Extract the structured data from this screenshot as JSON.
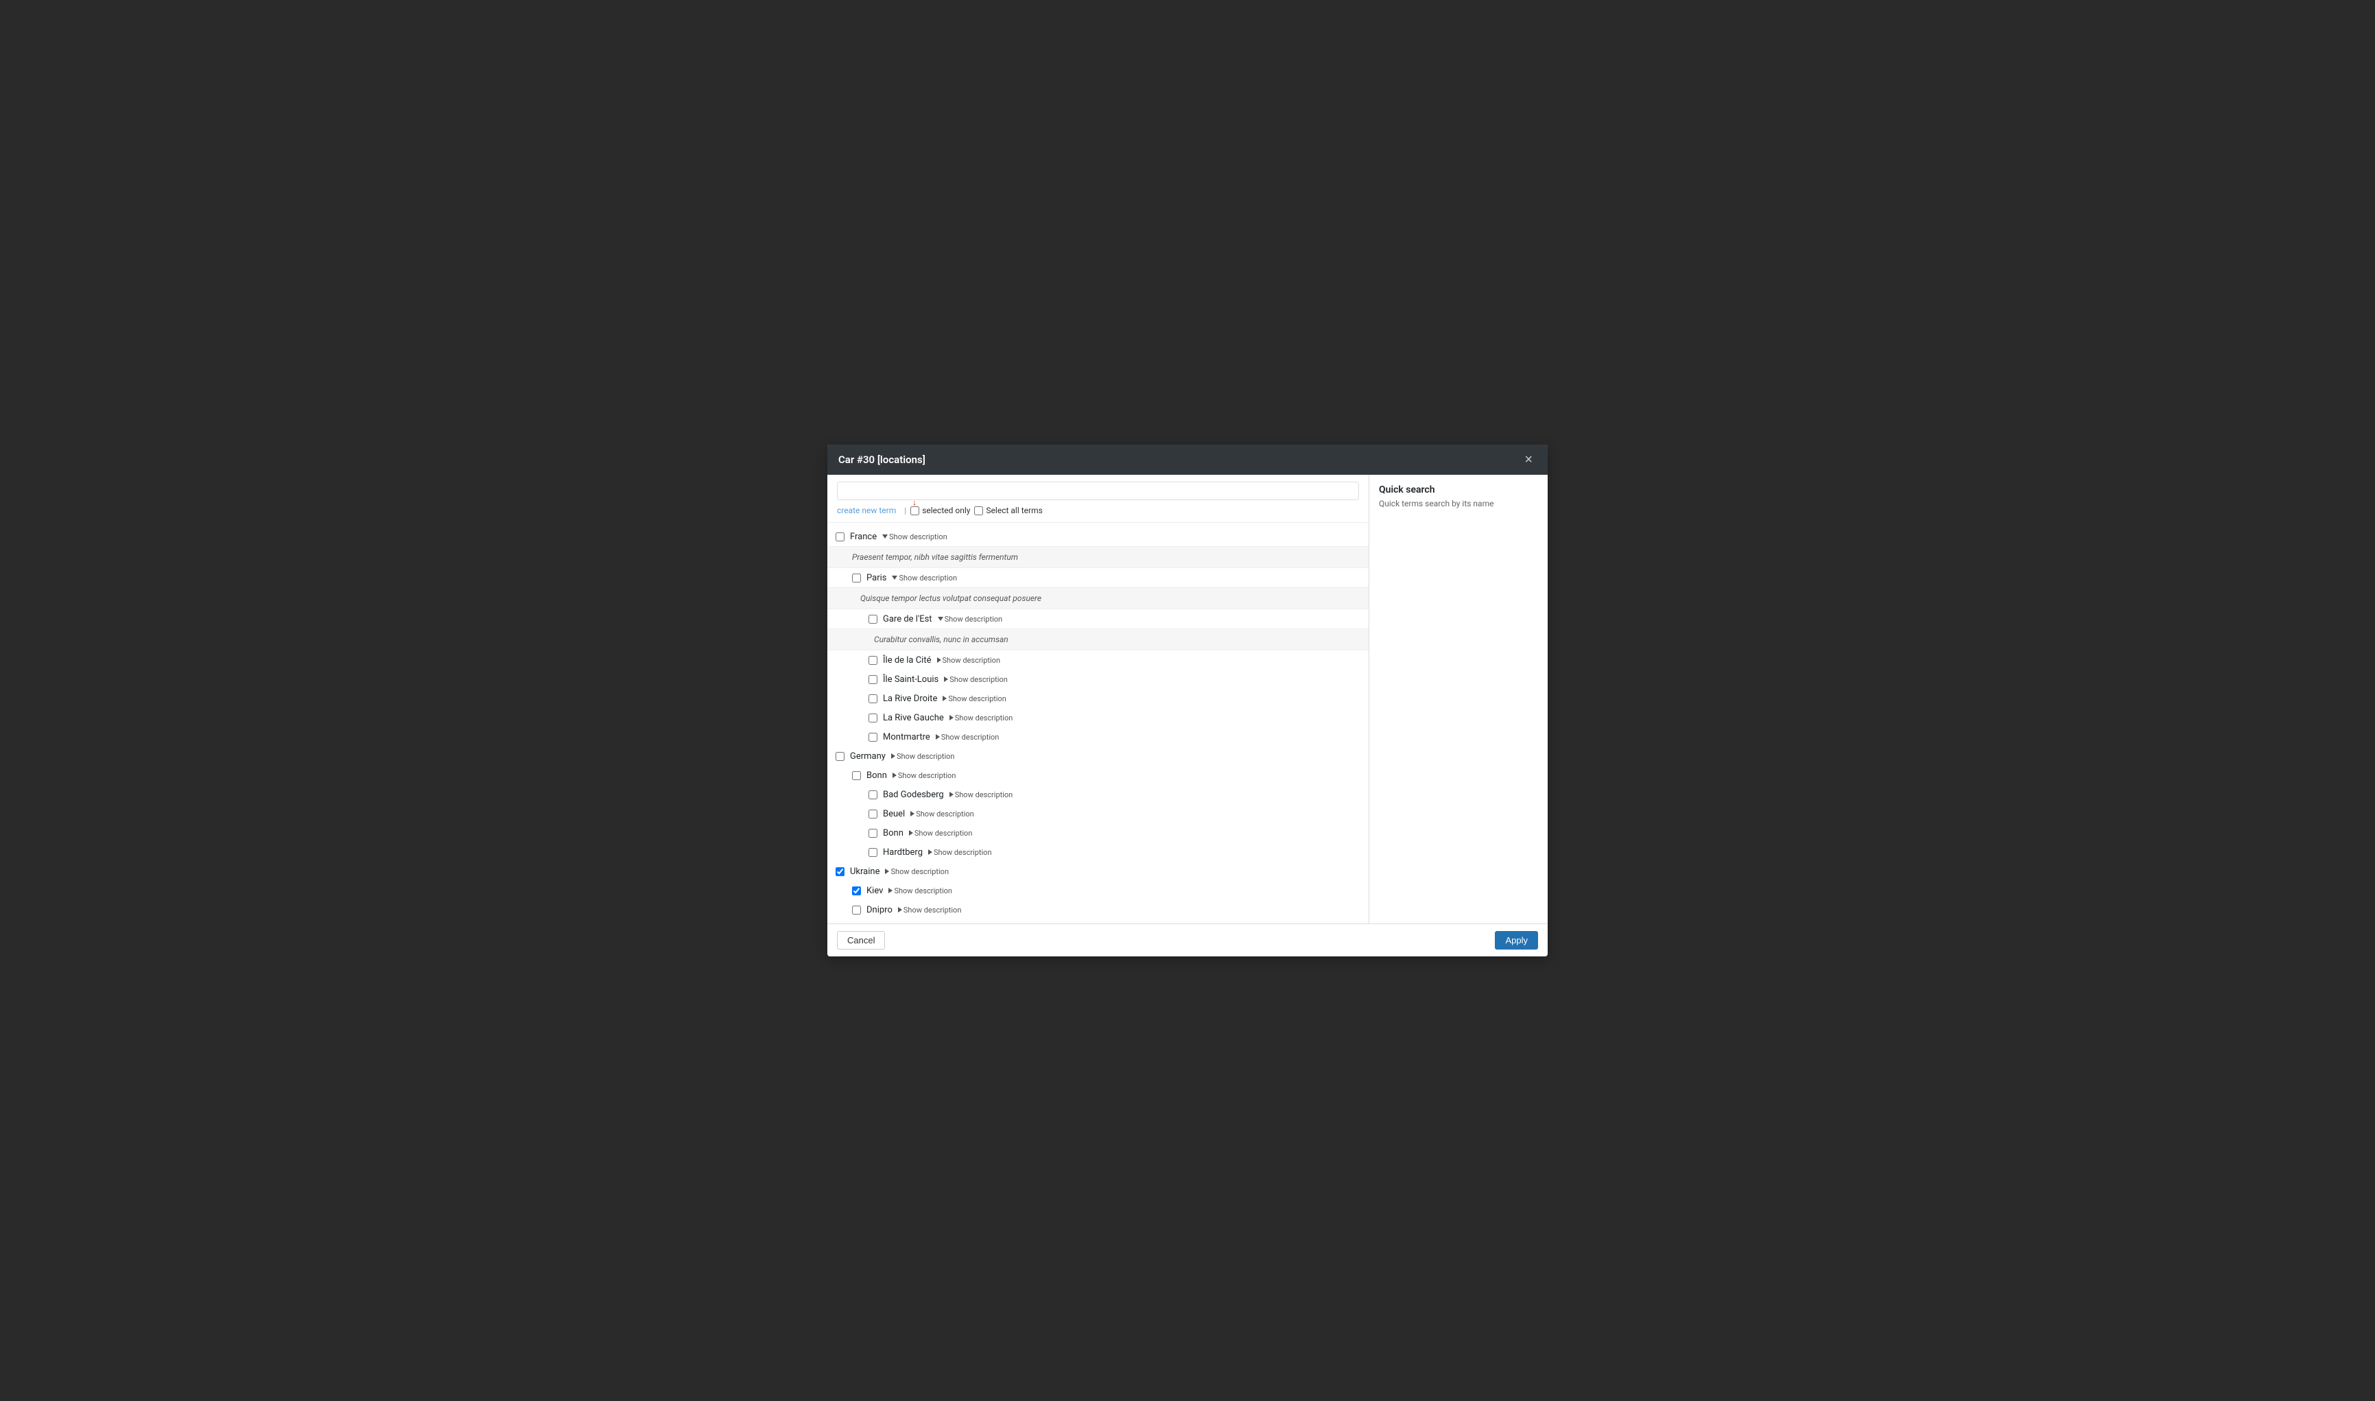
{
  "modal": {
    "title": "Car #30 [locations]",
    "close_label": "×"
  },
  "toolbar": {
    "search_placeholder": "",
    "create_link_label": "create new term",
    "separator": "|",
    "selected_only_label": "selected only",
    "select_all_label": "Select all terms"
  },
  "sidebar": {
    "title": "Quick search",
    "description": "Quick terms search by its name"
  },
  "footer": {
    "cancel_label": "Cancel",
    "apply_label": "Apply"
  },
  "terms": [
    {
      "id": "france",
      "label": "France",
      "level": 0,
      "checked": false,
      "show_desc_label": "Show description",
      "desc_open": true,
      "desc_text": "Praesent tempor, nibh vitae sagittis fermentum",
      "children": [
        {
          "id": "paris",
          "label": "Paris",
          "level": 1,
          "checked": false,
          "show_desc_label": "Show description",
          "desc_open": true,
          "desc_text": "Quisque tempor lectus volutpat consequat posuere",
          "children": [
            {
              "id": "gare-de-lest",
              "label": "Gare de l'Est",
              "level": 2,
              "checked": false,
              "show_desc_label": "Show description",
              "desc_open": true,
              "desc_text": "Curabitur convallis, nunc in accumsan"
            },
            {
              "id": "ile-de-la-cite",
              "label": "Île de la Cité",
              "level": 2,
              "checked": false,
              "show_desc_label": "Show description",
              "desc_open": false
            },
            {
              "id": "ile-saint-louis",
              "label": "Île Saint-Louis",
              "level": 2,
              "checked": false,
              "show_desc_label": "Show description",
              "desc_open": false
            },
            {
              "id": "la-rive-droite",
              "label": "La Rive Droite",
              "level": 2,
              "checked": false,
              "show_desc_label": "Show description",
              "desc_open": false
            },
            {
              "id": "la-rive-gauche",
              "label": "La Rive Gauche",
              "level": 2,
              "checked": false,
              "show_desc_label": "Show description",
              "desc_open": false
            },
            {
              "id": "montmartre",
              "label": "Montmartre",
              "level": 2,
              "checked": false,
              "show_desc_label": "Show description",
              "desc_open": false
            }
          ]
        }
      ]
    },
    {
      "id": "germany",
      "label": "Germany",
      "level": 0,
      "checked": false,
      "show_desc_label": "Show description",
      "desc_open": false,
      "children": [
        {
          "id": "bonn-city",
          "label": "Bonn",
          "level": 1,
          "checked": false,
          "show_desc_label": "Show description",
          "desc_open": false,
          "children": [
            {
              "id": "bad-godesberg",
              "label": "Bad Godesberg",
              "level": 2,
              "checked": false,
              "show_desc_label": "Show description",
              "desc_open": false
            },
            {
              "id": "beuel",
              "label": "Beuel",
              "level": 2,
              "checked": false,
              "show_desc_label": "Show description",
              "desc_open": false
            },
            {
              "id": "bonn-district",
              "label": "Bonn",
              "level": 2,
              "checked": false,
              "show_desc_label": "Show description",
              "desc_open": false
            },
            {
              "id": "hardtberg",
              "label": "Hardtberg",
              "level": 2,
              "checked": false,
              "show_desc_label": "Show description",
              "desc_open": false
            }
          ]
        }
      ]
    },
    {
      "id": "ukraine",
      "label": "Ukraine",
      "level": 0,
      "checked": true,
      "show_desc_label": "Show description",
      "desc_open": false,
      "children": [
        {
          "id": "kiev",
          "label": "Kiev",
          "level": 1,
          "checked": true,
          "show_desc_label": "Show description",
          "desc_open": false
        },
        {
          "id": "dnipro",
          "label": "Dnipro",
          "level": 1,
          "checked": false,
          "show_desc_label": "Show description",
          "desc_open": false
        }
      ]
    }
  ]
}
